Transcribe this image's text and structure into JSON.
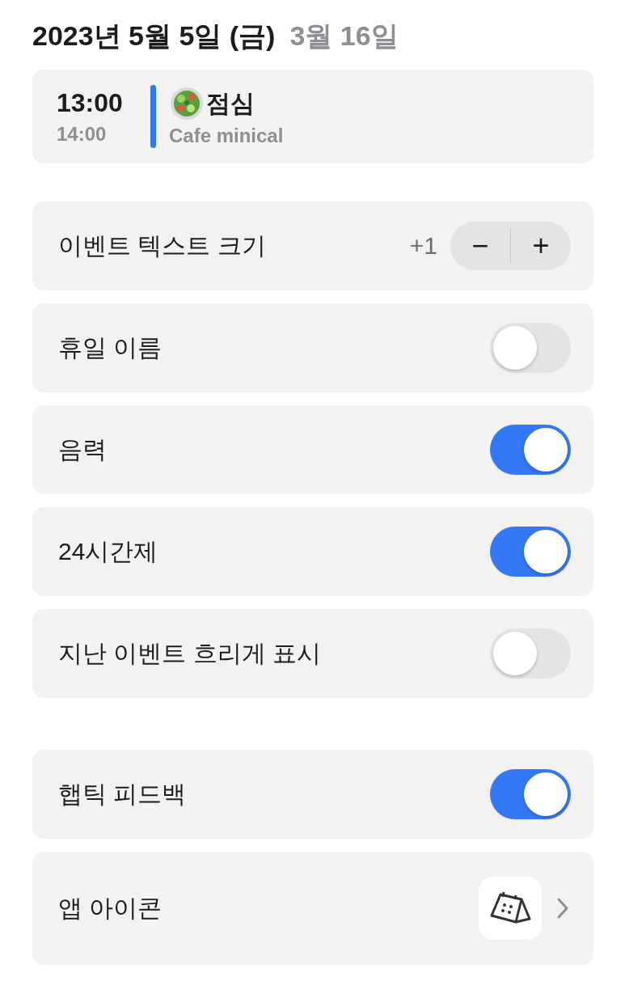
{
  "header": {
    "date": "2023년 5월 5일 (금)",
    "lunar_date": "3월 16일"
  },
  "event": {
    "start": "13:00",
    "end": "14:00",
    "title": "점심",
    "location": "Cafe minical",
    "color": "#3478f6"
  },
  "settings_groups": [
    [
      {
        "kind": "stepper",
        "label": "이벤트 텍스트 크기",
        "value": "+1",
        "minus": "−",
        "plus": "+"
      },
      {
        "kind": "toggle",
        "label": "휴일 이름",
        "on": false
      },
      {
        "kind": "toggle",
        "label": "음력",
        "on": true
      },
      {
        "kind": "toggle",
        "label": "24시간제",
        "on": true
      },
      {
        "kind": "toggle",
        "label": "지난 이벤트 흐리게 표시",
        "on": false
      }
    ],
    [
      {
        "kind": "toggle",
        "label": "햅틱 피드백",
        "on": true
      },
      {
        "kind": "link",
        "label": "앱 아이콘"
      }
    ]
  ]
}
